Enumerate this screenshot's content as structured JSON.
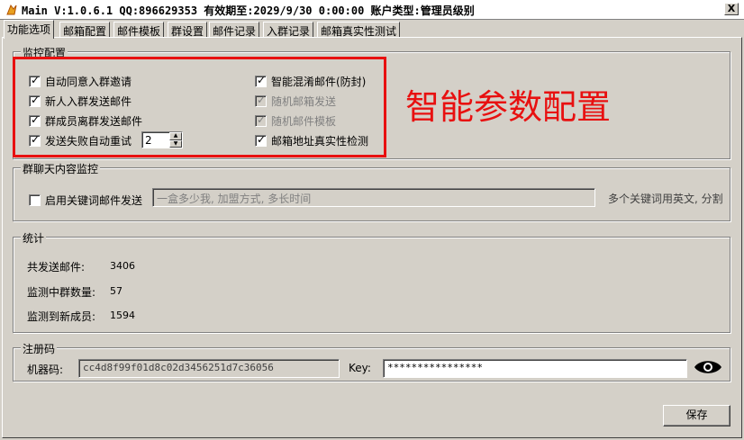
{
  "window": {
    "title": "Main V:1.0.6.1 QQ:896629353 有效期至:2029/9/30 0:00:00 账户类型:管理员级别",
    "close_label": "X"
  },
  "tabs": [
    {
      "label": "功能选项",
      "active": true
    },
    {
      "label": "邮箱配置"
    },
    {
      "label": "邮件模板"
    },
    {
      "label": "群设置"
    },
    {
      "label": "邮件记录"
    },
    {
      "label": "入群记录"
    },
    {
      "label": "邮箱真实性测试"
    }
  ],
  "monitor": {
    "title": "监控配置",
    "items": {
      "auto_accept": "自动同意入群邀请",
      "new_member_mail": "新人入群发送邮件",
      "leave_mail": "群成员离群发送邮件",
      "retry_on_fail": "发送失败自动重试",
      "retry_count": "2",
      "smart_mix": "智能混淆邮件(防封)",
      "random_mailbox": "随机邮箱发送",
      "random_template": "随机邮件模板",
      "verify_address": "邮箱地址真实性检测"
    },
    "banner": "智能参数配置",
    "banner_color": "#e81010"
  },
  "chat_monitor": {
    "title": "群聊天内容监控",
    "keyword_label": "启用关键词邮件发送",
    "keyword_value": "一盒多少我, 加盟方式, 多长时间",
    "hint": "多个关键词用英文, 分割"
  },
  "stats": {
    "title": "统计",
    "sent_label": "共发送邮件:",
    "sent_value": "3406",
    "groups_label": "监测中群数量:",
    "groups_value": "57",
    "members_label": "监测到新成员:",
    "members_value": "1594"
  },
  "registration": {
    "title": "注册码",
    "machine_label": "机器码:",
    "machine_value": "cc4d8f99f01d8c02d3456251d7c36056",
    "key_label": "Key:",
    "key_value": "****************",
    "eye_icon": "eye-icon"
  },
  "footer": {
    "save_label": "保存"
  }
}
